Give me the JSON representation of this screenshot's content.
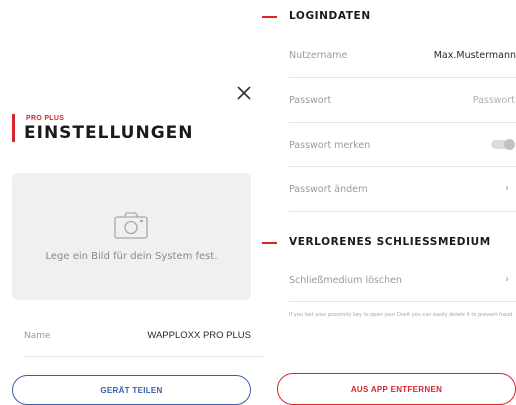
{
  "left": {
    "pro_label": "PRO PLUS",
    "title": "EINSTELLUNGEN",
    "image_hint": "Lege ein Bild für dein System fest.",
    "name_label": "Name",
    "name_value": "WAPPLOXX PRO PLUS",
    "share_button": "GERÄT TEILEN"
  },
  "login": {
    "section_title": "LOGINDATEN",
    "username_label": "Nutzername",
    "username_value": "Max.Mustermann",
    "password_label": "Passwort",
    "password_placeholder": "Passwort",
    "remember_label": "Passwort merken",
    "remember_on": false,
    "change_label": "Passwort ändern"
  },
  "lost_medium": {
    "section_title": "VERLORENES SCHLIESSMEDIUM",
    "delete_label": "Schließmedium löschen",
    "info": "If you lost your proximity key to open your Doxit you can easily delete it to prevent fraud."
  },
  "remove_button": "AUS APP ENTFERNEN",
  "icons": {
    "close": "close-icon",
    "camera": "camera-icon",
    "chevron": "chevron-right-icon"
  },
  "colors": {
    "accent": "#d9252b",
    "link_blue": "#3a5ea8",
    "card_bg": "#f0f0f0"
  }
}
